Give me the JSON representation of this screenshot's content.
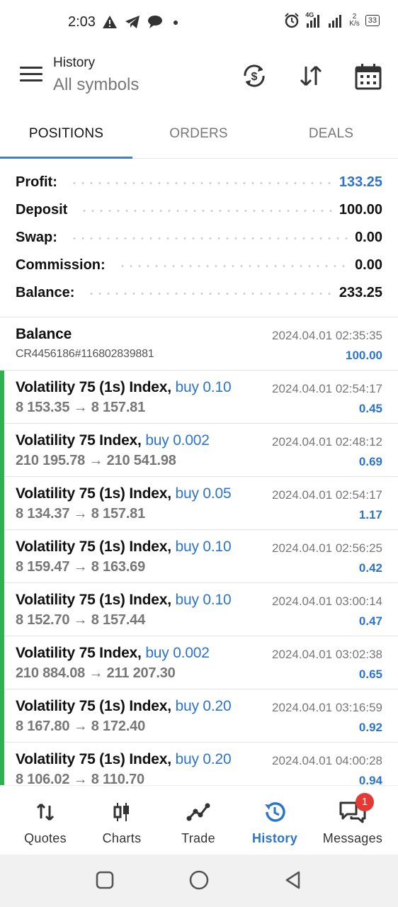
{
  "status_bar": {
    "time": "2:03",
    "network_type": "4G",
    "data_rate": "2",
    "data_rate_unit": "K/s",
    "battery": "33"
  },
  "header": {
    "title": "History",
    "subtitle": "All symbols",
    "icons": [
      "currency-exchange-icon",
      "sort-icon",
      "calendar-icon"
    ]
  },
  "tabs": [
    {
      "label": "POSITIONS",
      "active": true
    },
    {
      "label": "ORDERS",
      "active": false
    },
    {
      "label": "DEALS",
      "active": false
    }
  ],
  "summary": [
    {
      "label": "Profit:",
      "value": "133.25",
      "highlight": true
    },
    {
      "label": "Deposit",
      "value": "100.00",
      "highlight": false
    },
    {
      "label": "Swap:",
      "value": "0.00",
      "highlight": false
    },
    {
      "label": "Commission:",
      "value": "0.00",
      "highlight": false
    },
    {
      "label": "Balance:",
      "value": "233.25",
      "highlight": false
    }
  ],
  "balance_entry": {
    "title": "Balance",
    "reference": "CR4456186#116802839881",
    "datetime": "2024.04.01 02:35:35",
    "amount": "100.00"
  },
  "positions": [
    {
      "symbol": "Volatility 75 (1s) Index,",
      "side": "buy 0.10",
      "prices": "8 153.35 → 8 157.81",
      "datetime": "2024.04.01 02:54:17",
      "profit": "0.45"
    },
    {
      "symbol": "Volatility 75 Index,",
      "side": "buy 0.002",
      "prices": "210 195.78 → 210 541.98",
      "datetime": "2024.04.01 02:48:12",
      "profit": "0.69"
    },
    {
      "symbol": "Volatility 75 (1s) Index,",
      "side": "buy 0.05",
      "prices": "8 134.37 → 8 157.81",
      "datetime": "2024.04.01 02:54:17",
      "profit": "1.17"
    },
    {
      "symbol": "Volatility 75 (1s) Index,",
      "side": "buy 0.10",
      "prices": "8 159.47 → 8 163.69",
      "datetime": "2024.04.01 02:56:25",
      "profit": "0.42"
    },
    {
      "symbol": "Volatility 75 (1s) Index,",
      "side": "buy 0.10",
      "prices": "8 152.70 → 8 157.44",
      "datetime": "2024.04.01 03:00:14",
      "profit": "0.47"
    },
    {
      "symbol": "Volatility 75 Index,",
      "side": "buy 0.002",
      "prices": "210 884.08 → 211 207.30",
      "datetime": "2024.04.01 03:02:38",
      "profit": "0.65"
    },
    {
      "symbol": "Volatility 75 (1s) Index,",
      "side": "buy 0.20",
      "prices": "8 167.80 → 8 172.40",
      "datetime": "2024.04.01 03:16:59",
      "profit": "0.92"
    },
    {
      "symbol": "Volatility 75 (1s) Index,",
      "side": "buy 0.20",
      "prices": "8 106.02 → 8 110.70",
      "datetime": "2024.04.01 04:00:28",
      "profit": "0.94"
    }
  ],
  "bottom_nav": [
    {
      "label": "Quotes",
      "icon": "quotes-arrows-icon",
      "active": false
    },
    {
      "label": "Charts",
      "icon": "candlestick-icon",
      "active": false
    },
    {
      "label": "Trade",
      "icon": "trend-line-icon",
      "active": false
    },
    {
      "label": "History",
      "icon": "history-clock-icon",
      "active": true
    },
    {
      "label": "Messages",
      "icon": "chat-bubbles-icon",
      "active": false,
      "badge": "1"
    }
  ],
  "colors": {
    "accent": "#2c74cc",
    "position_bar": "#2fb150",
    "badge": "#e53935"
  }
}
